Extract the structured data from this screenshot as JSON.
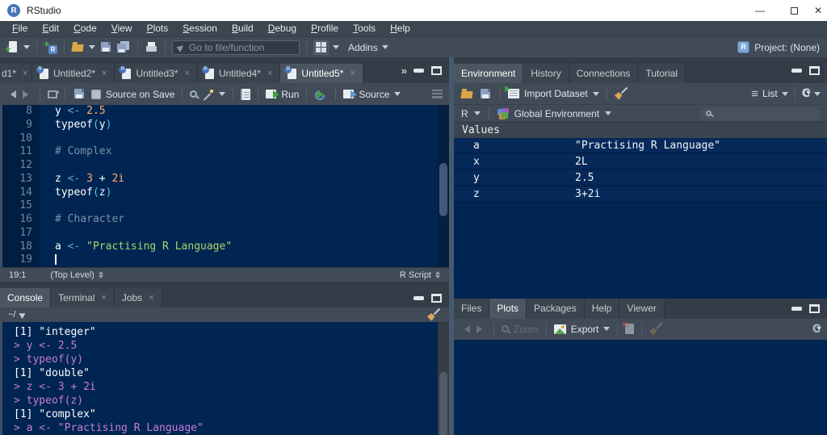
{
  "theme": {
    "chrome": "#414B57",
    "editor_bg": "#002552",
    "string_green": "#A9D46A",
    "number_orange": "#FFAE6B",
    "operator_blue": "#71A3DC",
    "comment_gray": "#7B8EA8",
    "command_purple": "#C77BD9"
  },
  "window": {
    "title": "RStudio"
  },
  "menubar": {
    "items": [
      "File",
      "Edit",
      "Code",
      "View",
      "Plots",
      "Session",
      "Build",
      "Debug",
      "Profile",
      "Tools",
      "Help"
    ]
  },
  "toolbar": {
    "goto_placeholder": "Go to file/function",
    "addins_label": "Addins",
    "project_label": "Project: (None)"
  },
  "source_pane": {
    "tabs": [
      {
        "label": "d1*",
        "partial": true
      },
      {
        "label": "Untitled2*"
      },
      {
        "label": "Untitled3*"
      },
      {
        "label": "Untitled4*"
      },
      {
        "label": "Untitled5*",
        "active": true
      }
    ],
    "toolbar": {
      "source_on_save": "Source on Save",
      "run": "Run",
      "source": "Source"
    },
    "editor": {
      "lines": [
        {
          "n": 8,
          "tokens": [
            [
              "y ",
              "w"
            ],
            [
              "<- ",
              "o"
            ],
            [
              "2.5",
              "n"
            ]
          ]
        },
        {
          "n": 9,
          "tokens": [
            [
              "typeof",
              "w"
            ],
            [
              "(",
              "p"
            ],
            [
              "y",
              "w"
            ],
            [
              ")",
              "p"
            ]
          ]
        },
        {
          "n": 10,
          "tokens": []
        },
        {
          "n": 11,
          "tokens": [
            [
              "# Complex",
              "c"
            ]
          ]
        },
        {
          "n": 12,
          "tokens": []
        },
        {
          "n": 13,
          "tokens": [
            [
              "z ",
              "w"
            ],
            [
              "<- ",
              "o"
            ],
            [
              "3",
              "n"
            ],
            [
              " + ",
              "w"
            ],
            [
              "2i",
              "n"
            ]
          ]
        },
        {
          "n": 14,
          "tokens": [
            [
              "typeof",
              "w"
            ],
            [
              "(",
              "p"
            ],
            [
              "z",
              "w"
            ],
            [
              ")",
              "p"
            ]
          ]
        },
        {
          "n": 15,
          "tokens": []
        },
        {
          "n": 16,
          "tokens": [
            [
              "# Character",
              "c"
            ]
          ]
        },
        {
          "n": 17,
          "tokens": []
        },
        {
          "n": 18,
          "tokens": [
            [
              "a ",
              "w"
            ],
            [
              "<- ",
              "o"
            ],
            [
              "\"Practising R Language\"",
              "s"
            ]
          ]
        },
        {
          "n": 19,
          "tokens": [],
          "caret": true
        }
      ]
    },
    "status": {
      "position": "19:1",
      "scope": "(Top Level)",
      "file_type": "R Script"
    }
  },
  "console_pane": {
    "tabs": [
      {
        "label": "Console",
        "active": true
      },
      {
        "label": "Terminal",
        "closable": true
      },
      {
        "label": "Jobs",
        "closable": true
      }
    ],
    "path": "~/",
    "lines": [
      {
        "text": "[1] \"integer\"",
        "kind": "out"
      },
      {
        "text": "> y <- 2.5",
        "kind": "in"
      },
      {
        "text": "> typeof(y)",
        "kind": "in"
      },
      {
        "text": "[1] \"double\"",
        "kind": "out"
      },
      {
        "text": "> z <- 3 + 2i",
        "kind": "in"
      },
      {
        "text": "> typeof(z)",
        "kind": "in"
      },
      {
        "text": "[1] \"complex\"",
        "kind": "out"
      },
      {
        "text": "> a <- \"Practising R Language\"",
        "kind": "in"
      }
    ]
  },
  "environment_pane": {
    "tabs": [
      {
        "label": "Environment",
        "active": true
      },
      {
        "label": "History"
      },
      {
        "label": "Connections"
      },
      {
        "label": "Tutorial"
      }
    ],
    "toolbar": {
      "import_dataset": "Import Dataset",
      "list": "List"
    },
    "selector": {
      "language": "R",
      "environment": "Global Environment"
    },
    "section_header": "Values",
    "values": [
      {
        "name": "a",
        "value": "\"Practising R Language\""
      },
      {
        "name": "x",
        "value": "2L"
      },
      {
        "name": "y",
        "value": "2.5"
      },
      {
        "name": "z",
        "value": "3+2i"
      }
    ]
  },
  "plots_pane": {
    "tabs": [
      {
        "label": "Files"
      },
      {
        "label": "Plots",
        "active": true
      },
      {
        "label": "Packages"
      },
      {
        "label": "Help"
      },
      {
        "label": "Viewer"
      }
    ],
    "toolbar": {
      "zoom": "Zoom",
      "export": "Export"
    }
  }
}
